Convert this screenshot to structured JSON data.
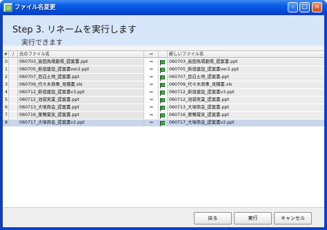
{
  "window": {
    "title": "ファイル名変更"
  },
  "header": {
    "step_title": "Step 3. リネームを実行します",
    "subtitle": "実行できます"
  },
  "grid": {
    "headers": {
      "num": "#",
      "sort": "/",
      "old": "元のファイル名",
      "arrow": "⇒",
      "flag": "",
      "new": "新しいファイル名"
    },
    "rows": [
      {
        "num": "0",
        "old": "060703_高田馬場劇場_提案書.ppt",
        "new": "060703_高田馬場劇場_提案書.ppt"
      },
      {
        "num": "1",
        "old": "060705_新宿建設_提案書ver2.ppt",
        "new": "060705_新宿建設_提案書ver2.ppt"
      },
      {
        "num": "2",
        "old": "060707_目白土地_提案書.ppt",
        "new": "060707_目白土地_提案書.ppt"
      },
      {
        "num": "3",
        "old": "060709_代々木商事_見積書.xls",
        "new": "060709_代々木商事_見積書.xls"
      },
      {
        "num": "4",
        "old": "060712_新宿建設_提案書v3.ppt",
        "new": "060712_新宿建設_提案書v3.ppt"
      },
      {
        "num": "5",
        "old": "060712_池袋実業_提案書.ppt",
        "new": "060712_池袋実業_提案書.ppt"
      },
      {
        "num": "6",
        "old": "060713_大塚商会_提案書.ppt",
        "new": "060713_大塚商会_提案書.ppt"
      },
      {
        "num": "7",
        "old": "060716_巣鴨電気_提案書.ppt",
        "new": "060716_巣鴨電気_提案書.ppt"
      },
      {
        "num": "8",
        "old": "060717_大塚商会_提案書v2.ppt",
        "new": "060717_大塚商会_提案書v2.ppt"
      }
    ]
  },
  "footer": {
    "back": "戻る",
    "run": "実行",
    "cancel": "キャンセル"
  }
}
